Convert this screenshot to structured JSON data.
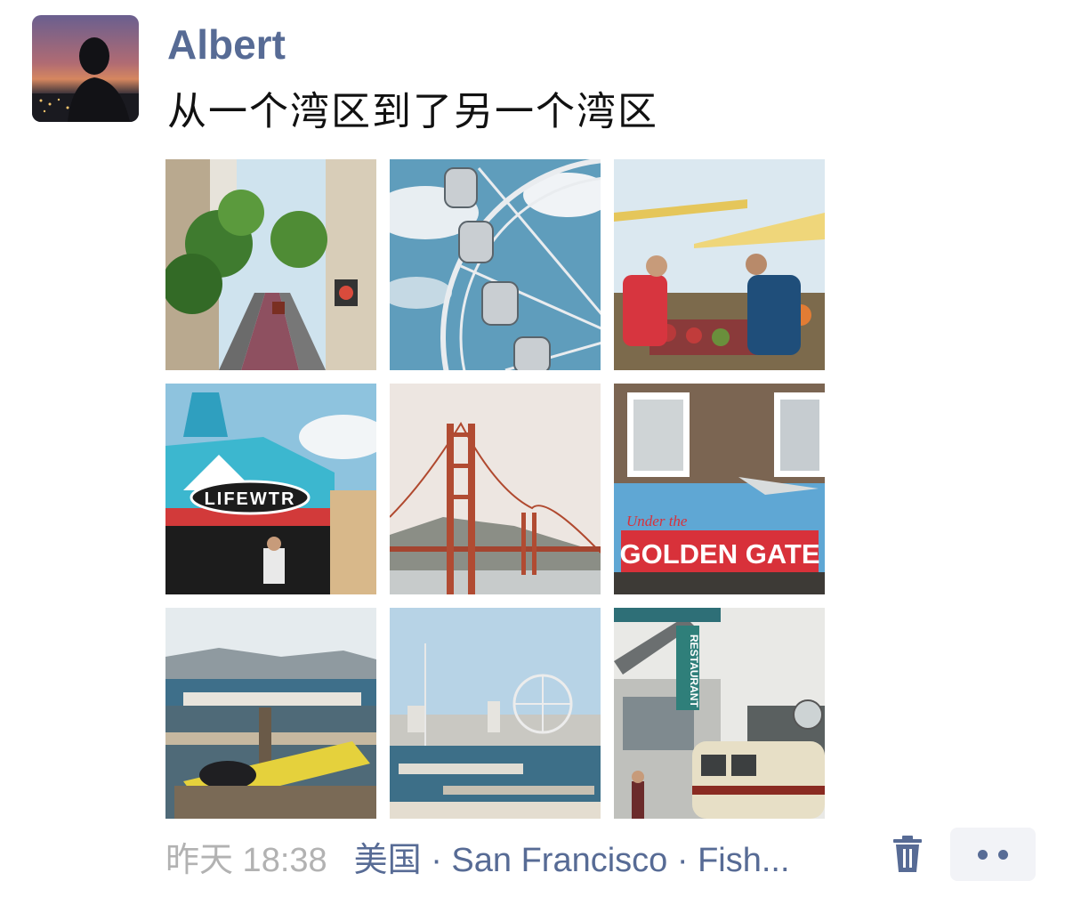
{
  "post": {
    "author": "Albert",
    "text": "从一个湾区到了另一个湾区",
    "timestamp": "昨天 18:38",
    "location": "美国 · San Francisco · Fish...",
    "photos": [
      {
        "name": "photo-street-hill"
      },
      {
        "name": "photo-ferris-wheel-closeup"
      },
      {
        "name": "photo-market-vendors"
      },
      {
        "name": "photo-carousel-lifewtr",
        "sign_text": "LIFEWTR"
      },
      {
        "name": "photo-golden-gate-bridge"
      },
      {
        "name": "photo-golden-gate-sign",
        "sign_text_top": "Under the",
        "sign_text": "GOLDEN GATE"
      },
      {
        "name": "photo-harbor-boats"
      },
      {
        "name": "photo-marina-ferris-wheel"
      },
      {
        "name": "photo-streetcar-restaurant",
        "sign_text": "RESTAURANT"
      }
    ]
  },
  "actions": {
    "delete_icon": "trash-icon",
    "more_icon": "more-icon"
  },
  "colors": {
    "link": "#576b95",
    "muted": "#b2b2b2",
    "text": "#111111"
  }
}
